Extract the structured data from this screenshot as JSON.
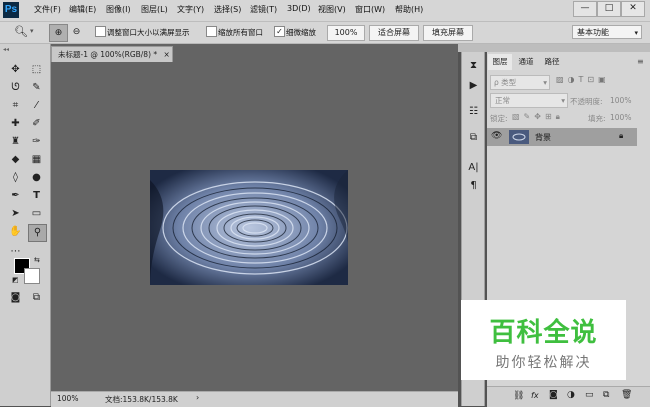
{
  "app": {
    "logo": "Ps"
  },
  "menu": [
    "文件(F)",
    "编辑(E)",
    "图像(I)",
    "图层(L)",
    "文字(Y)",
    "选择(S)",
    "滤镜(T)",
    "3D(D)",
    "视图(V)",
    "窗口(W)",
    "帮助(H)"
  ],
  "window_controls": {
    "minimize": "—",
    "maximize": "□",
    "close": "✕"
  },
  "options": {
    "resize_label": "调整窗口大小以满屏显示",
    "resize_checked": false,
    "zoom_all_label": "缩放所有窗口",
    "zoom_all_checked": false,
    "scrubby_label": "细微缩放",
    "scrubby_checked": true,
    "zoom_value": "100%",
    "fit_screen": "适合屏幕",
    "fill_screen": "填充屏幕",
    "workspace": "基本功能"
  },
  "document": {
    "tab_title": "未标题-1 @ 100%(RGB/8) *",
    "tab_close": "×",
    "zoom": "100%",
    "doc_info": "文档:153.8K/153.8K"
  },
  "layers_panel": {
    "tabs": [
      "图层",
      "通道",
      "路径"
    ],
    "filter_label": "类型",
    "blend_mode": "正常",
    "opacity_label": "不透明度:",
    "opacity_value": "100%",
    "lock_label": "锁定:",
    "fill_label": "填充:",
    "fill_value": "100%",
    "layers": [
      {
        "name": "背景",
        "visible": true,
        "locked": true
      }
    ],
    "bottom_icons": [
      "link-icon",
      "fx-icon",
      "mask-icon",
      "adjustment-icon",
      "group-icon",
      "new-layer-icon",
      "delete-icon"
    ],
    "fx_label": "fx"
  },
  "watermark": {
    "title": "百科全说",
    "subtitle": "助你轻松解决"
  }
}
